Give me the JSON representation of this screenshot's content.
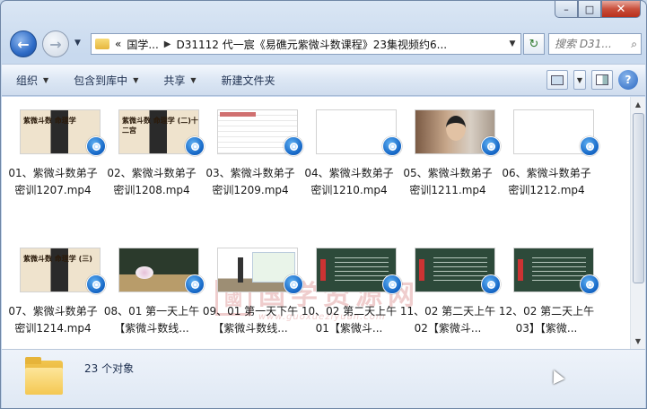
{
  "window": {
    "caption": {
      "minimize": "–",
      "maximize": "□",
      "close": "✕"
    }
  },
  "nav": {
    "back_glyph": "←",
    "forward_glyph": "→",
    "dropdown_glyph": "▼",
    "breadcrumb": [
      "«",
      "国学...",
      "D31112 代一宸《易礁元紫微斗数课程》23集视频约6..."
    ],
    "breadcrumb_sep": "▶",
    "address_dropdown": "▼",
    "refresh_glyph": "↻",
    "search_placeholder": "搜索 D31...",
    "search_icon": "⌕"
  },
  "toolbar": {
    "organize": "组织",
    "include_in_library": "包含到库中",
    "share": "共享",
    "new_folder": "新建文件夹",
    "arrow": "▼",
    "help": "?"
  },
  "files": [
    {
      "name": "01、紫微斗数弟子密训1207.mp4",
      "thumb": "lady",
      "caption": "紫微斗数 命理学"
    },
    {
      "name": "02、紫微斗数弟子密训1208.mp4",
      "thumb": "lady",
      "caption": "紫微斗数 命理学 (二)十二宫"
    },
    {
      "name": "03、紫微斗数弟子密训1209.mp4",
      "thumb": "doc",
      "caption": "紫微斗数口诀"
    },
    {
      "name": "04、紫微斗数弟子密训1210.mp4",
      "thumb": "blank",
      "caption": ""
    },
    {
      "name": "05、紫微斗数弟子密训1211.mp4",
      "thumb": "woman",
      "caption": ""
    },
    {
      "name": "06、紫微斗数弟子密训1212.mp4",
      "thumb": "blank",
      "caption": ""
    },
    {
      "name": "07、紫微斗数弟子密训1214.mp4",
      "thumb": "lady",
      "caption": "紫微斗数 命理学 (三)"
    },
    {
      "name": "08、01 第一天上午【紫微斗数线...",
      "thumb": "stage",
      "caption": ""
    },
    {
      "name": "09、01 第一天下午【紫微斗数线...",
      "thumb": "screen",
      "caption": ""
    },
    {
      "name": "10、02 第二天上午01【紫微斗...",
      "thumb": "board",
      "caption": ""
    },
    {
      "name": "11、02 第二天上午02【紫微斗...",
      "thumb": "board",
      "caption": ""
    },
    {
      "name": "12、02 第二天上午03】【紫微...",
      "thumb": "board",
      "caption": ""
    }
  ],
  "watermark": {
    "seal": "國",
    "chinese": "国学资源网",
    "url": "www.guoxueziyuan.com"
  },
  "status": {
    "count_text": "23 个对象"
  }
}
